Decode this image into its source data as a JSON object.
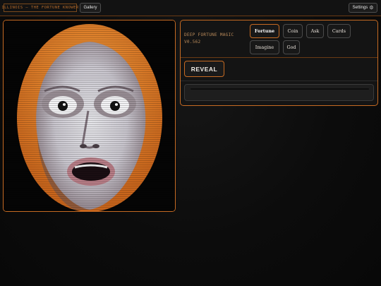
{
  "header": {
    "brand": "ILLINOIS — THE FORTUNE KNOWER",
    "gallery_label": "Gallery",
    "settings_label": "Settings",
    "settings_icon": "gear-icon"
  },
  "panel": {
    "title_line1": "DEEP FORTUNE MAGIC",
    "title_line2": "V0.562",
    "modes": [
      "Fortune",
      "Coin",
      "Ask",
      "Cards",
      "Imagine",
      "God"
    ],
    "active_mode": "Fortune",
    "reveal_label": "REVEAL",
    "output_text": ""
  },
  "colors": {
    "accent": "#c56a22",
    "background": "#0b0b0b",
    "hair": "#e98a2a"
  }
}
